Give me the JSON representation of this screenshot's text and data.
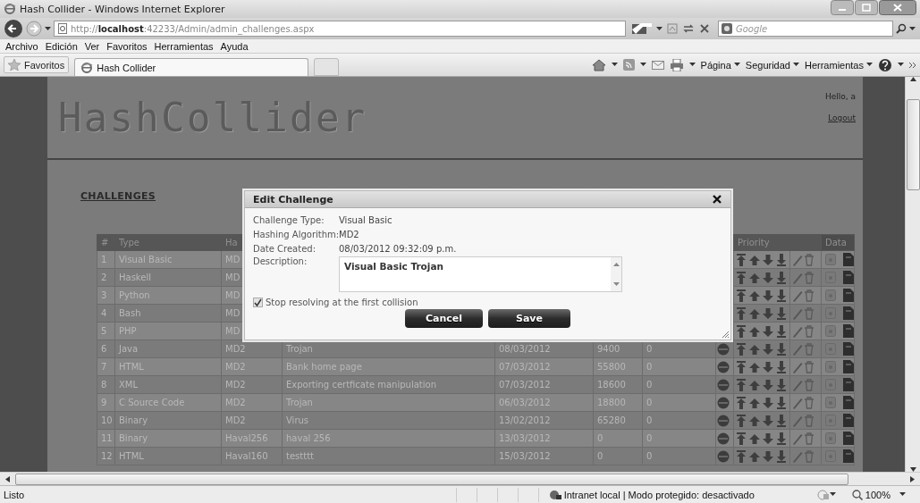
{
  "window": {
    "title": "Hash Collider - Windows Internet Explorer"
  },
  "address_bar": {
    "url": "http://**localhost**:42233/Admin/admin_challenges.aspx",
    "search_placeholder": "Google"
  },
  "menu": [
    "Archivo",
    "Edición",
    "Ver",
    "Favoritos",
    "Herramientas",
    "Ayuda"
  ],
  "favorites_bar": {
    "favorites": "Favoritos",
    "tab": "Hash Collider",
    "commands": [
      "Página",
      "Seguridad",
      "Herramientas"
    ]
  },
  "page": {
    "logo": "HashCollider",
    "greeting": "Hello, a",
    "logout": "Logout",
    "section": "CHALLENGES"
  },
  "table": {
    "header": {
      "number": "#",
      "type": "Type",
      "hashing": "Ha",
      "priority": "Priority",
      "data": "Data"
    },
    "rows": [
      {
        "number": "1",
        "type": "Visual Basic",
        "hash": "MD"
      },
      {
        "number": "2",
        "type": "Haskell",
        "hash": "MD"
      },
      {
        "number": "3",
        "type": "Python",
        "hash": "MD"
      },
      {
        "number": "4",
        "type": "Bash",
        "hash": "MD"
      },
      {
        "number": "5",
        "type": "PHP",
        "hash": "MD"
      },
      {
        "number": "6",
        "type": "Java",
        "hash": "MD2",
        "description": "Trojan",
        "date": "08/03/2012",
        "column_6": "9400",
        "column_7": "0"
      },
      {
        "number": "7",
        "type": "HTML",
        "hash": "MD2",
        "description": "Bank home page",
        "date": "07/03/2012",
        "column_6": "55800",
        "column_7": "0"
      },
      {
        "number": "8",
        "type": "XML",
        "hash": "MD2",
        "description": "Exporting certficate manipulation",
        "date": "07/03/2012",
        "column_6": "18600",
        "column_7": "0"
      },
      {
        "number": "9",
        "type": "C Source Code",
        "hash": "MD2",
        "description": "Trojan",
        "date": "06/03/2012",
        "column_6": "18800",
        "column_7": "0"
      },
      {
        "number": "10",
        "type": "Binary",
        "hash": "MD2",
        "description": "Virus",
        "date": "13/02/2012",
        "column_6": "65280",
        "column_7": "0"
      },
      {
        "number": "11",
        "type": "Binary",
        "hash": "Haval256",
        "description": "haval 256",
        "date": "13/03/2012",
        "column_6": "0",
        "column_7": "0"
      },
      {
        "number": "12",
        "type": "HTML",
        "hash": "Haval160",
        "description": "testttt",
        "date": "15/03/2012",
        "column_6": "0",
        "column_7": "0"
      }
    ]
  },
  "dialog": {
    "title": "Edit Challenge",
    "fields": [
      {
        "label": "Challenge Type:",
        "value": "Visual Basic"
      },
      {
        "label": "Hashing Algorithm:",
        "value": "MD2"
      },
      {
        "label": "Date Created:",
        "value": "08/03/2012 09:32:09 p.m."
      }
    ],
    "description_label": "Description:",
    "description": "Visual Basic Trojan",
    "stop_checkbox": {
      "label": "Stop resolving at the first collision",
      "checked": true
    },
    "buttons": [
      "Cancel",
      "Save"
    ]
  },
  "status_bar": {
    "text": "Listo",
    "zone": "Intranet local | Modo protegido: desactivado",
    "zoom": "100%"
  }
}
